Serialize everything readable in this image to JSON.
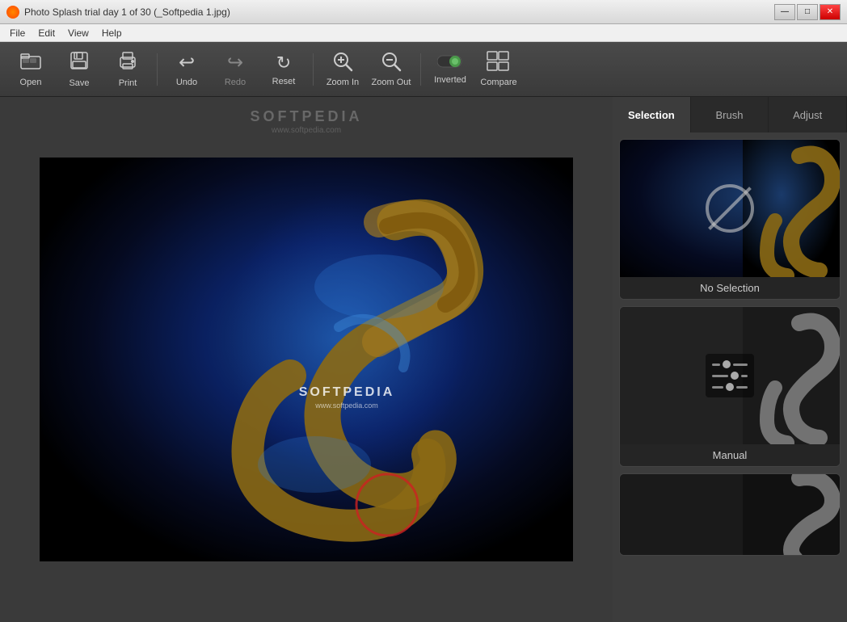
{
  "window": {
    "title": "Photo Splash trial day 1 of 30 (_Softpedia 1.jpg)",
    "icon": "photo-icon"
  },
  "titlebar": {
    "buttons": {
      "minimize": "—",
      "maximize": "□",
      "close": "✕"
    }
  },
  "menu": {
    "items": [
      "File",
      "Edit",
      "View",
      "Help"
    ]
  },
  "toolbar": {
    "buttons": [
      {
        "id": "open",
        "label": "Open",
        "icon": "🖼"
      },
      {
        "id": "save",
        "label": "Save",
        "icon": "💾"
      },
      {
        "id": "print",
        "label": "Print",
        "icon": "🖨"
      },
      {
        "id": "undo",
        "label": "Undo",
        "icon": "↩"
      },
      {
        "id": "redo",
        "label": "Redo",
        "icon": "↪"
      },
      {
        "id": "reset",
        "label": "Reset",
        "icon": "🔄"
      },
      {
        "id": "zoom-in",
        "label": "Zoom In",
        "icon": "🔍"
      },
      {
        "id": "zoom-out",
        "label": "Zoom Out",
        "icon": "🔎"
      },
      {
        "id": "inverted",
        "label": "Inverted",
        "icon": "circle"
      },
      {
        "id": "compare",
        "label": "Compare",
        "icon": "⊞"
      }
    ]
  },
  "tabs": [
    {
      "id": "selection",
      "label": "Selection",
      "active": true
    },
    {
      "id": "brush",
      "label": "Brush",
      "active": false
    },
    {
      "id": "adjust",
      "label": "Adjust",
      "active": false
    }
  ],
  "selection_cards": [
    {
      "id": "no-selection",
      "label": "No Selection"
    },
    {
      "id": "manual",
      "label": "Manual"
    },
    {
      "id": "third",
      "label": ""
    }
  ],
  "softpedia": {
    "brand": "SOFTPEDIA",
    "url": "www.softpedia.com",
    "watermark": "www.softpedia.com"
  },
  "colors": {
    "accent_yellow": "#c8a000",
    "toolbar_bg": "#3a3a3a",
    "panel_bg": "#3c3c3c",
    "card_bg": "#252525",
    "active_tab": "#3c3c3c",
    "inactive_tab": "#2a2a2a"
  }
}
